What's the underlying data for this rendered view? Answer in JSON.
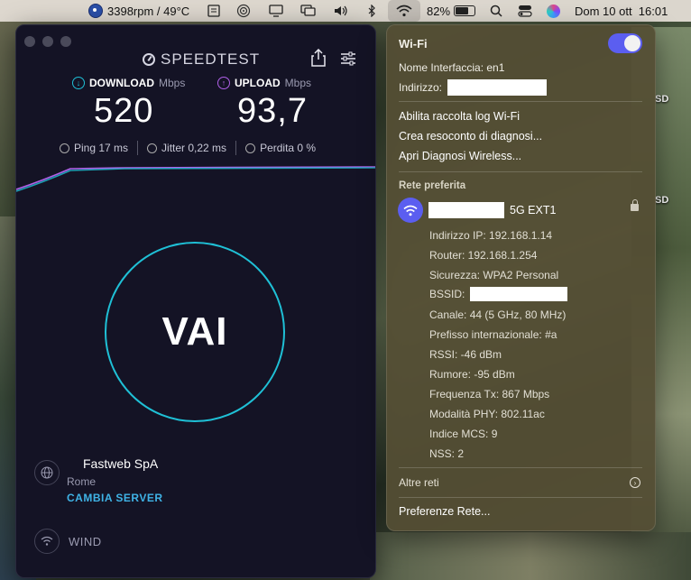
{
  "menubar": {
    "cpu_stats": "3398rpm / 49°C",
    "battery_percent": "82%",
    "battery_level": 0.82,
    "date_time": "Dom 10 ott  16:01"
  },
  "speedtest": {
    "title": "SPEEDTEST",
    "download": {
      "label": "DOWNLOAD",
      "unit": "Mbps",
      "value": "520",
      "color": "#1fc0d6"
    },
    "upload": {
      "label": "UPLOAD",
      "unit": "Mbps",
      "value": "93,7",
      "color": "#b060e8"
    },
    "ping": "Ping 17 ms",
    "jitter": "Jitter 0,22 ms",
    "loss": "Perdita 0 %",
    "go_label": "VAI",
    "server": {
      "provider": "Fastweb SpA",
      "city": "Rome",
      "change_label": "CAMBIA SERVER"
    },
    "isp": "WIND"
  },
  "wifi": {
    "title": "Wi-Fi",
    "enabled": true,
    "interface": "Nome Interfaccia: en1",
    "address_label": "Indirizzo:",
    "menu": {
      "log": "Abilita raccolta log Wi-Fi",
      "report": "Crea resoconto di diagnosi...",
      "diagnostics": "Apri Diagnosi Wireless..."
    },
    "preferred_label": "Rete preferita",
    "network_suffix": "5G EXT1",
    "details": {
      "ip": "Indirizzo IP: 192.168.1.14",
      "router": "Router: 192.168.1.254",
      "security": "Sicurezza: WPA2 Personal",
      "bssid_label": "BSSID:",
      "channel": "Canale: 44 (5 GHz, 80 MHz)",
      "country": "Prefisso internazionale: #a",
      "rssi": "RSSI: -46 dBm",
      "noise": "Rumore: -95 dBm",
      "tx_rate": "Frequenza Tx: 867 Mbps",
      "phy_mode": "Modalità PHY: 802.11ac",
      "mcs": "Indice MCS: 9",
      "nss": "NSS: 2"
    },
    "other_networks": "Altre reti",
    "preferences": "Preferenze Rete..."
  },
  "desktop": {
    "label_1": "SD",
    "label_2": "SD"
  }
}
